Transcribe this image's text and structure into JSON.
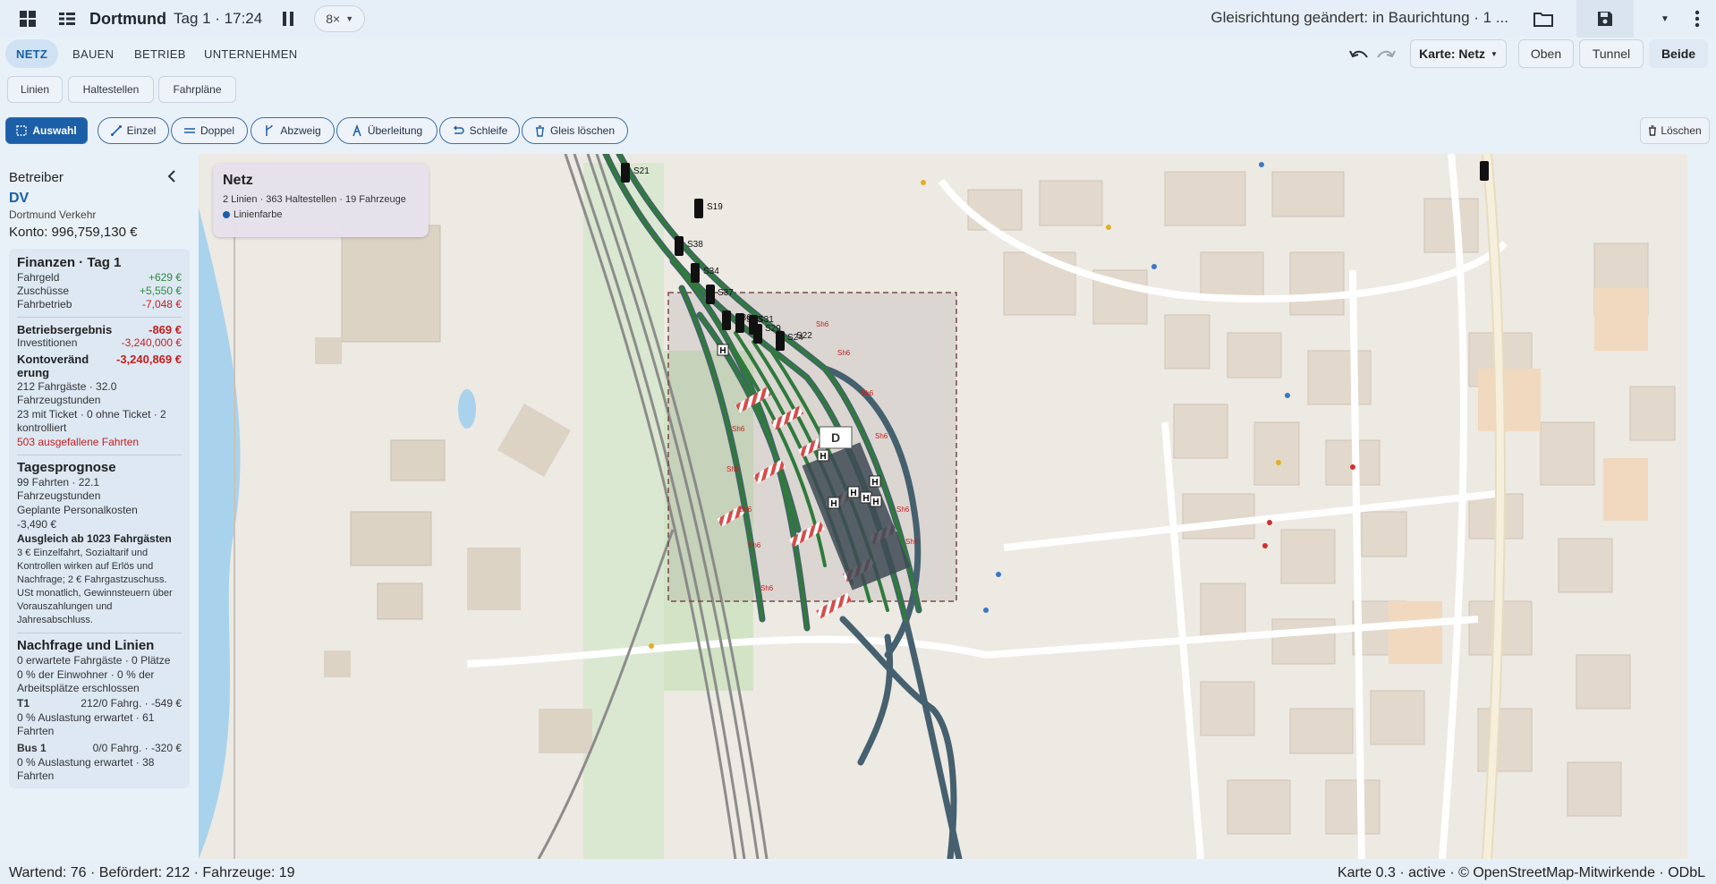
{
  "header": {
    "title": "Dortmund",
    "day_time": "Tag 1 · 17:24",
    "speed": "8×",
    "status_message": "Gleisrichtung geändert: in Baurichtung · 1 ..."
  },
  "tabs": [
    {
      "label": "NETZ",
      "active": true
    },
    {
      "label": "BAUEN",
      "active": false
    },
    {
      "label": "BETRIEB",
      "active": false
    },
    {
      "label": "UNTERNEHMEN",
      "active": false
    }
  ],
  "map_select": "Karte: Netz",
  "view_modes": [
    {
      "label": "Oben",
      "active": false
    },
    {
      "label": "Tunnel",
      "active": false
    },
    {
      "label": "Beide",
      "active": true
    }
  ],
  "subtabs": [
    "Linien",
    "Haltestellen",
    "Fahrpläne"
  ],
  "tools": [
    {
      "label": "Auswahl",
      "active": true
    },
    {
      "label": "Einzel"
    },
    {
      "label": "Doppel"
    },
    {
      "label": "Abzweig"
    },
    {
      "label": "Überleitung"
    },
    {
      "label": "Schleife"
    },
    {
      "label": "Gleis löschen"
    }
  ],
  "delete_label": "Löschen",
  "sidebar": {
    "title": "Betreiber",
    "operator_short": "DV",
    "operator_name": "Dortmund Verkehr",
    "balance": "Konto: 996,759,130 €",
    "finance": {
      "title": "Finanzen · Tag 1",
      "rows": [
        {
          "label": "Fahrgeld",
          "value": "+629 €",
          "sign": "pos"
        },
        {
          "label": "Zuschüsse",
          "value": "+5,550 €",
          "sign": "pos"
        },
        {
          "label": "Fahrbetrieb",
          "value": "-7,048 €",
          "sign": "neg"
        }
      ],
      "operating_result_label": "Betriebsergebnis",
      "operating_result_value": "-869 €",
      "investments_label": "Investitionen",
      "investments_value": "-3,240,000 €",
      "change_label": "Kontoveränd erung",
      "change_value": "-3,240,869 €",
      "passengers": "212 Fahrgäste · 32.0 Fahrzeugstunden",
      "tickets": "23 mit Ticket · 0 ohne Ticket · 2 kontrolliert",
      "cancelled": "503 ausgefallene Fahrten"
    },
    "forecast": {
      "title": "Tagesprognose",
      "trips": "99 Fahrten · 22.1 Fahrzeugstunden",
      "staff_label": "Geplante Personalkosten",
      "staff_value": "-3,490 €",
      "breakeven": "Ausgleich ab 1023 Fahrgästen",
      "note": "3 € Einzelfahrt, Sozialtarif und Kontrollen wirken auf Erlös und Nachfrage; 2 € Fahrgastzuschuss. USt monatlich, Gewinnsteuern über Vorauszahlungen und Jahresabschluss."
    },
    "demand": {
      "title": "Nachfrage und Linien",
      "expected": "0 erwartete Fahrgäste · 0 Plätze",
      "coverage": "0 % der Einwohner · 0 % der Arbeitsplätze erschlossen",
      "lines": [
        {
          "name": "T1",
          "stats": "212/0 Fahrg. · -549 €",
          "detail": "0 % Auslastung erwartet · 61 Fahrten"
        },
        {
          "name": "Bus 1",
          "stats": "0/0 Fahrg. · -320 €",
          "detail": "0 % Auslastung erwartet · 38 Fahrten"
        }
      ]
    }
  },
  "info_box": {
    "title": "Netz",
    "summary": "2 Linien · 363 Haltestellen · 19 Fahrzeuge",
    "legend": "Linienfarbe"
  },
  "signals": [
    "S21",
    "S19",
    "S38",
    "S34",
    "S37",
    "S36",
    "S33",
    "S31",
    "S29",
    "S24",
    "S22"
  ],
  "map_badges": [
    "Sh6",
    "H",
    "D"
  ],
  "statusbar": {
    "left": "Wartend: 76 · Befördert: 212 · Fahrzeuge: 19",
    "right": "Karte 0.3 · active · © OpenStreetMap-Mitwirkende · ODbL"
  },
  "colors": {
    "accent": "#1a5fa8",
    "positive": "#2f8a3e",
    "negative": "#c32020",
    "track_green": "#2f7a3c",
    "map_bg": "#ede9e3"
  }
}
